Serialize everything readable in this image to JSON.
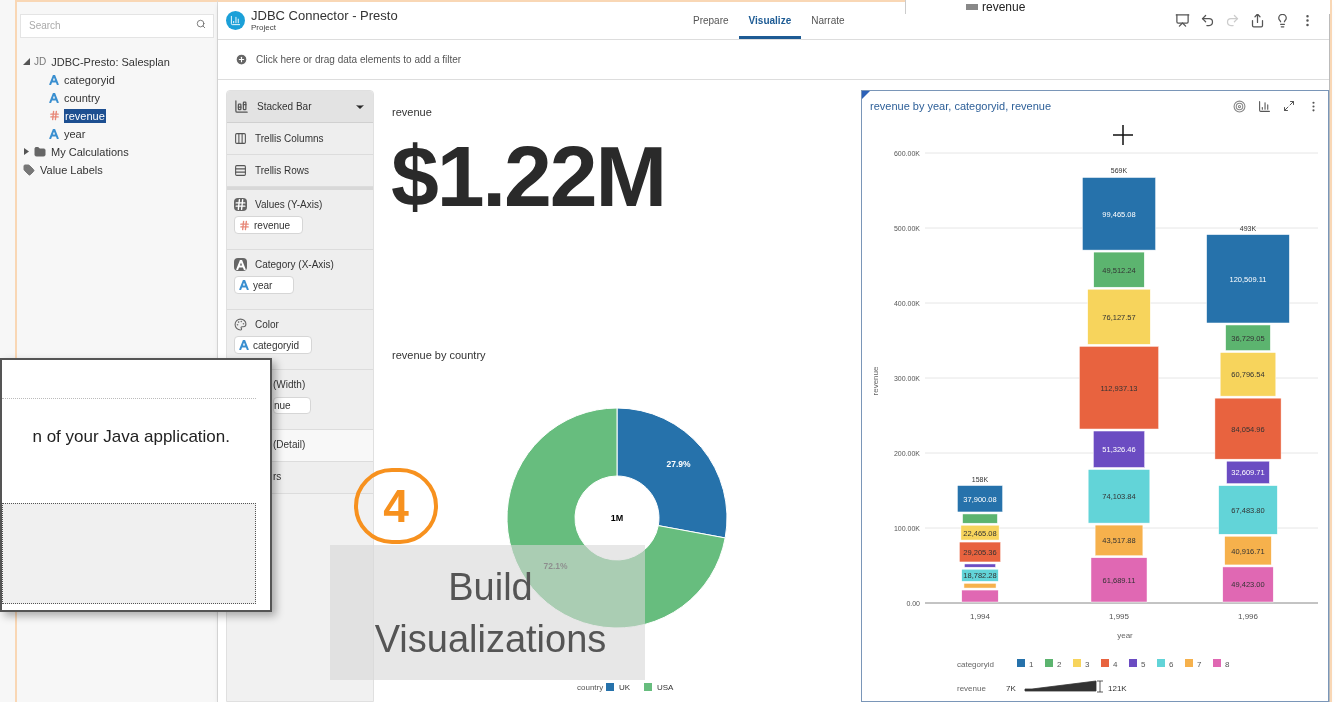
{
  "background_window": {
    "text": "revenue"
  },
  "sidebar": {
    "search": {
      "placeholder": "Search"
    },
    "tree": [
      {
        "prefix": "JD",
        "label": "JDBC-Presto: Salesplan",
        "kind": "source",
        "expanded": true,
        "selected": false,
        "children": [
          {
            "label": "categoryid",
            "kind": "attribute",
            "selected": false
          },
          {
            "label": "country",
            "kind": "attribute",
            "selected": false
          },
          {
            "label": "revenue",
            "kind": "measure",
            "selected": true
          },
          {
            "label": "year",
            "kind": "attribute",
            "selected": false
          }
        ]
      },
      {
        "label": "My Calculations",
        "kind": "folder",
        "expanded": false,
        "selected": false
      },
      {
        "label": "Value Labels",
        "kind": "labels",
        "selected": false
      }
    ]
  },
  "header": {
    "title": "JDBC Connector - Presto",
    "subtitle": "Project",
    "tabs": [
      {
        "label": "Prepare",
        "selected": false
      },
      {
        "label": "Visualize",
        "selected": true
      },
      {
        "label": "Narrate",
        "selected": false
      }
    ],
    "toolbar": [
      {
        "kind": "present",
        "disabled": false
      },
      {
        "kind": "undo",
        "disabled": false
      },
      {
        "kind": "redo",
        "disabled": true
      },
      {
        "kind": "share",
        "disabled": false
      },
      {
        "kind": "insight",
        "disabled": false
      },
      {
        "kind": "more",
        "disabled": false
      }
    ]
  },
  "filter_bar": {
    "text": "Click here or drag data elements to add a filter"
  },
  "grammar": {
    "vis_type": "Stacked Bar",
    "layouts": [
      {
        "label": "Trellis Columns",
        "kind": "columns"
      },
      {
        "label": "Trellis Rows",
        "kind": "rows"
      }
    ],
    "drop_zones": [
      {
        "label": "Values (Y-Axis)",
        "kind": "values",
        "chip": {
          "label": "revenue",
          "kind": "measure"
        }
      },
      {
        "label": "Category (X-Axis)",
        "kind": "category",
        "chip": {
          "label": "year",
          "kind": "attribute"
        }
      },
      {
        "label": "Color",
        "kind": "color",
        "chip": {
          "label": "categoryid",
          "kind": "attribute"
        }
      },
      {
        "label": "(Width)",
        "kind": "partial",
        "chip": {
          "label": "nue",
          "kind": "partial"
        }
      },
      {
        "label": "(Detail)",
        "kind": "partial_light"
      },
      {
        "label": "rs",
        "kind": "partial"
      }
    ]
  },
  "kpi": {
    "title": "revenue",
    "value": "$1.22M"
  },
  "donut": {
    "center_label": "1M",
    "chart_data": {
      "type": "donut",
      "title": "revenue by country",
      "categories": [
        "UK",
        "USA"
      ],
      "values": [
        27.9,
        72.1
      ],
      "colors": [
        "#2672ab",
        "#67bd7e"
      ],
      "value_labels": [
        "27.9%",
        "72.1%"
      ],
      "legend": {
        "title": "country"
      }
    }
  },
  "bar_card": {
    "width_legend": {
      "title": "revenue",
      "min": "7K",
      "max": "121K"
    },
    "chart_data": {
      "type": "bar",
      "stacked": true,
      "orientation": "vertical",
      "title": "revenue by year, categoryid, revenue",
      "xlabel": "year",
      "ylabel": "revenue",
      "categories": [
        "1,994",
        "1,995",
        "1,996"
      ],
      "series": [
        {
          "name": "1",
          "color": "#2672ab",
          "values": [
            37900.08,
            99465.08,
            120509.11
          ],
          "value_labels": [
            "37,900.08",
            "99,465.08",
            "120,509.11"
          ]
        },
        {
          "name": "2",
          "color": "#5cb46f",
          "values": [
            15000,
            49512.24,
            36729.05
          ],
          "value_labels": [
            null,
            "49,512.24",
            "36,729.05"
          ]
        },
        {
          "name": "3",
          "color": "#f7d45c",
          "values": [
            22465.08,
            76127.57,
            60796.54
          ],
          "value_labels": [
            "22,465.08",
            "76,127.57",
            "60,796.54"
          ]
        },
        {
          "name": "4",
          "color": "#e8633f",
          "values": [
            29205.36,
            112937.13,
            84054.96
          ],
          "value_labels": [
            "29,205.36",
            "112,937.13",
            "84,054.96"
          ]
        },
        {
          "name": "5",
          "color": "#6b4cc2",
          "values": [
            7000,
            51326.46,
            32609.71
          ],
          "value_labels": [
            null,
            "51,326.46",
            "32,609.71"
          ]
        },
        {
          "name": "6",
          "color": "#62d4d8",
          "values": [
            18782.28,
            74103.84,
            67483.8
          ],
          "value_labels": [
            "18,782.28",
            "74,103.84",
            "67,483.80"
          ]
        },
        {
          "name": "7",
          "color": "#f6b14c",
          "values": [
            9000,
            43517.88,
            40916.71
          ],
          "value_labels": [
            null,
            "43,517.88",
            "40,916.71"
          ]
        },
        {
          "name": "8",
          "color": "#e068b3",
          "values": [
            18600,
            61689.11,
            49423
          ],
          "value_labels": [
            null,
            "61,689.11",
            "49,423.00"
          ]
        }
      ],
      "ylim": [
        0,
        600000
      ],
      "yticks": [
        {
          "value": 0,
          "label": "0.00"
        },
        {
          "value": 100000,
          "label": "100.00K"
        },
        {
          "value": 200000,
          "label": "200.00K"
        },
        {
          "value": 300000,
          "label": "300.00K"
        },
        {
          "value": 400000,
          "label": "400.00K"
        },
        {
          "value": 500000,
          "label": "500.00K"
        },
        {
          "value": 600000,
          "label": "600.00K"
        }
      ],
      "grid": true,
      "legend": {
        "title": "categoryid"
      },
      "annotations": [
        "158K",
        "569K",
        "493K"
      ]
    }
  },
  "dialog": {
    "text": "n of your Java application."
  },
  "step_badge": {
    "number": "4",
    "caption": "Build Visualizations"
  }
}
